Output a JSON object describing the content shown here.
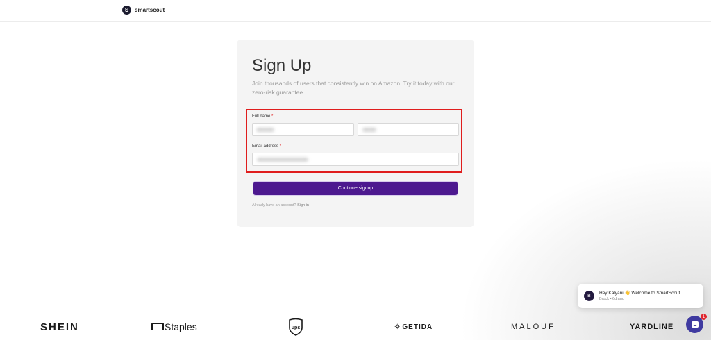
{
  "brand": {
    "name": "smartscout",
    "mark": "S"
  },
  "signup": {
    "title": "Sign Up",
    "subtitle": "Join thousands of users that consistently win on Amazon. Try it today with our zero-risk guarantee.",
    "full_name_label": "Full name",
    "email_label": "Email address",
    "required_mark": "*",
    "submit_label": "Continue signup",
    "signin_prompt": "Already have an account?",
    "signin_link": "Sign in",
    "highlight_color": "#e01e1e",
    "accent_color": "#4d198f"
  },
  "chat": {
    "avatar_letter": "B",
    "message": "Hey Kalyani 👋 Welcome to SmartScout...",
    "meta": "Brock • 6d ago",
    "badge_count": "1",
    "launcher_icon": "chat-bubble-icon"
  },
  "logos": {
    "shein": "SHEIN",
    "staples": "Staples",
    "ups": "ups",
    "getida": "GETIDA",
    "malouf": "MALOUF",
    "yardline": "YARDLINE"
  }
}
